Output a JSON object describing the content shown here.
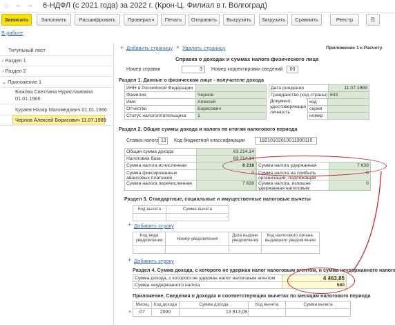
{
  "window": {
    "title": "6-НДФЛ (с 2021 года) за 2022 г. (Крон-Ц. Филиал в г. Волгоград)"
  },
  "toolbar": {
    "buttons": [
      "Записать",
      "Заполнить",
      "Расшифровать",
      "Проверка",
      "Печать",
      "Отправить",
      "Выгрузить",
      "Загрузить",
      "Сравнить",
      "Реестр"
    ]
  },
  "links": {
    "to_work": "В работе"
  },
  "left_pane": {
    "title_sheet": "Титульный лист",
    "section1": "Раздел 1",
    "section2": "Раздел 2",
    "appendix1": "Приложение 1",
    "persons": [
      {
        "name": "Бажова Светлана Нурисламовна",
        "date": "01.01.1966"
      },
      {
        "name": "Кураев Назар Магомедович 01.01.1966"
      },
      {
        "name": "Чернов Алексей Борисович 11.07.1989"
      }
    ]
  },
  "form": {
    "add_page": "Добавить страницу",
    "delete_page": "Удалить страницу",
    "appendix_label": "Приложение 1 к Расчету",
    "title": "Справка о доходах и суммах налога физического лица",
    "cert_number_label": "Номер справки",
    "cert_number": "3",
    "correction_label": "Номер корректировки сведений",
    "correction": "00",
    "section1": {
      "heading": "Раздел 1. Данные о физическом лице - получателе дохода",
      "inn_label": "ИНН в Российской Федерации",
      "surname_label": "Фамилия",
      "surname": "Чернов",
      "name_label": "Имя",
      "name": "Алексей",
      "patronymic_label": "Отчество",
      "patronymic": "Борисович",
      "status_label": "Статус налогоплательщика",
      "status": "1",
      "birth_label": "Дата рождения",
      "birth": "11.07.1989",
      "citizenship_label": "Гражданство (код страны)",
      "citizenship": "643",
      "doc_label": "Документ, удостоверяющий личность",
      "code_label": "код",
      "series_label": "серия",
      "number_label": "номер"
    },
    "section2": {
      "heading": "Раздел 2. Общие суммы дохода и налога по итогам налогового периода",
      "rate_label": "Ставка налога",
      "rate": "13",
      "kbk_label": "Код бюджетной классификации",
      "kbk": "18210102010011000110",
      "total_income_label": "Общая сумма дохода",
      "total_income": "63 214,14",
      "tax_base_label": "Налоговая база",
      "tax_base": "63 214,14",
      "tax_calc_label": "Сумма налога исчисленная",
      "tax_calc": "8 218",
      "tax_withheld_label": "Сумма налога удержанная",
      "tax_withheld": "7 638",
      "fixed_adv_label": "Сумма фиксированных авансовых платежей",
      "fixed_adv": "0",
      "profit_tax_label": "Сумма налога на прибыль организаций, подлежащая зачету",
      "profit_tax": "0",
      "tax_paid_label": "Сумма налога перечисленная",
      "tax_paid": "7 638",
      "excess_label": "Сумма налога, излишне удержанная налоговым агентом",
      "excess": "0"
    },
    "section3": {
      "heading": "Раздел 3. Стандартные, социальные и имущественные налоговые вычеты",
      "col_code": "Код вычета",
      "col_sum": "Сумма вычета",
      "add_row": "Добавить строку",
      "col_notice_type": "Код вида уведомления",
      "col_notice_no": "Номер уведомления",
      "col_notice_date": "Дата выдачи уведомления",
      "col_tax_org": "Код налогового органа, выдавшего уведомление"
    },
    "section4": {
      "heading": "Раздел 4. Сумма дохода, с которого не удержан налог налоговым агентом, и сумма неудержанного налога",
      "income_not_withheld_label": "Сумма дохода, с которого не удержан налог налоговым агентом",
      "income_not_withheld": "4 463,85",
      "tax_not_withheld_label": "Сумма неудержанного налога",
      "tax_not_withheld": "580"
    },
    "appendix": {
      "heading": "Приложение. Сведения о доходах и соответствующих вычетах по месяцам налогового периода",
      "cols": [
        "Месяц",
        "Код дохода",
        "Сумма дохода",
        "Код вычета",
        "Сумма вычета"
      ],
      "rows": [
        {
          "month": "07",
          "code": "2000",
          "sum": "13 913,08"
        }
      ]
    }
  }
}
